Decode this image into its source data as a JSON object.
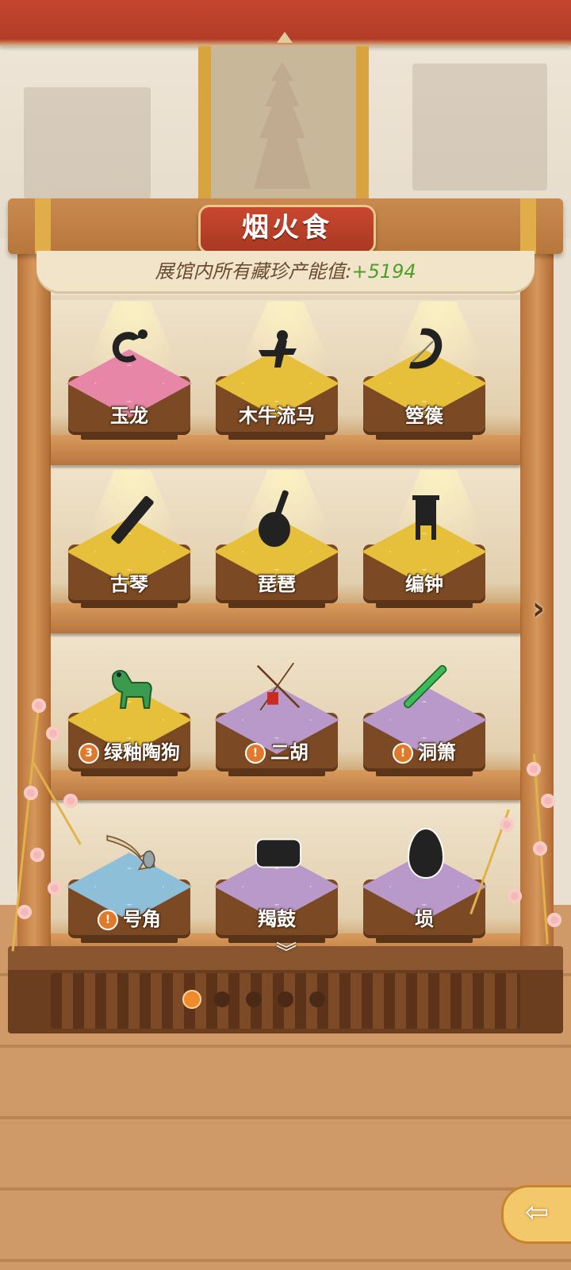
{
  "museum": {
    "title": "烟火食",
    "energy_label": "展馆内所有藏珍产能值:",
    "energy_value": "+5194"
  },
  "shelves": [
    {
      "items": [
        {
          "name": "玉龙",
          "cushion": "pink",
          "state": "silhouette",
          "icon": "jade-dragon-icon"
        },
        {
          "name": "木牛流马",
          "cushion": "gold",
          "state": "silhouette",
          "icon": "wooden-ox-icon"
        },
        {
          "name": "箜篌",
          "cushion": "gold",
          "state": "silhouette",
          "icon": "harp-icon"
        }
      ]
    },
    {
      "items": [
        {
          "name": "古琴",
          "cushion": "gold",
          "state": "silhouette",
          "icon": "guqin-icon"
        },
        {
          "name": "琵琶",
          "cushion": "gold",
          "state": "silhouette",
          "icon": "pipa-icon"
        },
        {
          "name": "编钟",
          "cushion": "gold",
          "state": "silhouette",
          "icon": "bianzhong-icon"
        }
      ]
    },
    {
      "items": [
        {
          "name": "绿釉陶狗",
          "cushion": "gold",
          "state": "collected",
          "badge": "3",
          "icon": "green-glazed-dog-icon"
        },
        {
          "name": "二胡",
          "cushion": "purple",
          "state": "collected",
          "badge": "!",
          "icon": "erhu-icon"
        },
        {
          "name": "洞箫",
          "cushion": "purple",
          "state": "collected",
          "badge": "!",
          "icon": "dongxiao-flute-icon"
        }
      ]
    },
    {
      "items": [
        {
          "name": "号角",
          "cushion": "blue",
          "state": "collected",
          "badge": "!",
          "icon": "horn-icon"
        },
        {
          "name": "羯鼓",
          "cushion": "purple",
          "state": "silhouette",
          "icon": "jiegu-drum-icon"
        },
        {
          "name": "埙",
          "cushion": "purple",
          "state": "silhouette",
          "icon": "xun-icon"
        }
      ]
    }
  ],
  "pagination": {
    "total": 5,
    "current": 1
  },
  "colors": {
    "banner": "#c4452e",
    "energy_value": "#4ea02b",
    "active_dot": "#f08a2a",
    "wood": "#b7763c"
  },
  "icons": {
    "next": "chevron-right-icon",
    "collapse": "chevron-down-icon",
    "back": "back-arrow-icon"
  }
}
